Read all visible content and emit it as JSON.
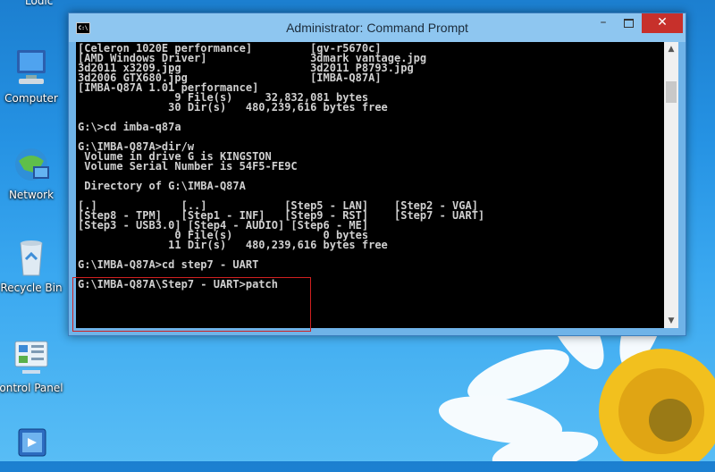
{
  "desktop": {
    "top_label": "Lodic",
    "icons": [
      {
        "label": "Computer",
        "icon": "computer-icon"
      },
      {
        "label": "Network",
        "icon": "network-icon"
      },
      {
        "label": "Recycle Bin",
        "icon": "recycle-bin-icon"
      },
      {
        "label": "ontrol Panel",
        "icon": "control-panel-icon"
      },
      {
        "label": "",
        "icon": "shortcut-icon"
      }
    ]
  },
  "window": {
    "title": "Administrator: Command Prompt",
    "controls": {
      "minimize": "–",
      "close": "✕"
    },
    "console_lines": [
      "[Celeron 1020E performance]         [gv-r5670c]",
      "[AMD Windows Driver]                3dmark vantage.jpg",
      "3d2011 x3209.jpg                    3d2011 P8793.jpg",
      "3d2006 GTX680.jpg                   [IMBA-Q87A]",
      "[IMBA-Q87A 1.01 performance]",
      "               9 File(s)     32,832,081 bytes",
      "              30 Dir(s)   480,239,616 bytes free",
      "",
      "G:\\>cd imba-q87a",
      "",
      "G:\\IMBA-Q87A>dir/w",
      " Volume in drive G is KINGSTON",
      " Volume Serial Number is 54F5-FE9C",
      "",
      " Directory of G:\\IMBA-Q87A",
      "",
      "[.]             [..]            [Step5 - LAN]    [Step2 - VGA]",
      "[Step8 - TPM]   [Step1 - INF]   [Step9 - RST]    [Step7 - UART]",
      "[Step3 - USB3.0] [Step4 - AUDIO] [Step6 - ME]",
      "               0 File(s)              0 bytes",
      "              11 Dir(s)   480,239,616 bytes free",
      "",
      "G:\\IMBA-Q87A>cd step7 - UART",
      "",
      "G:\\IMBA-Q87A\\Step7 - UART>patch"
    ]
  },
  "colors": {
    "console_bg": "#000000",
    "console_text": "#d0d0d0",
    "highlight": "#d02020",
    "close": "#c7302b"
  }
}
